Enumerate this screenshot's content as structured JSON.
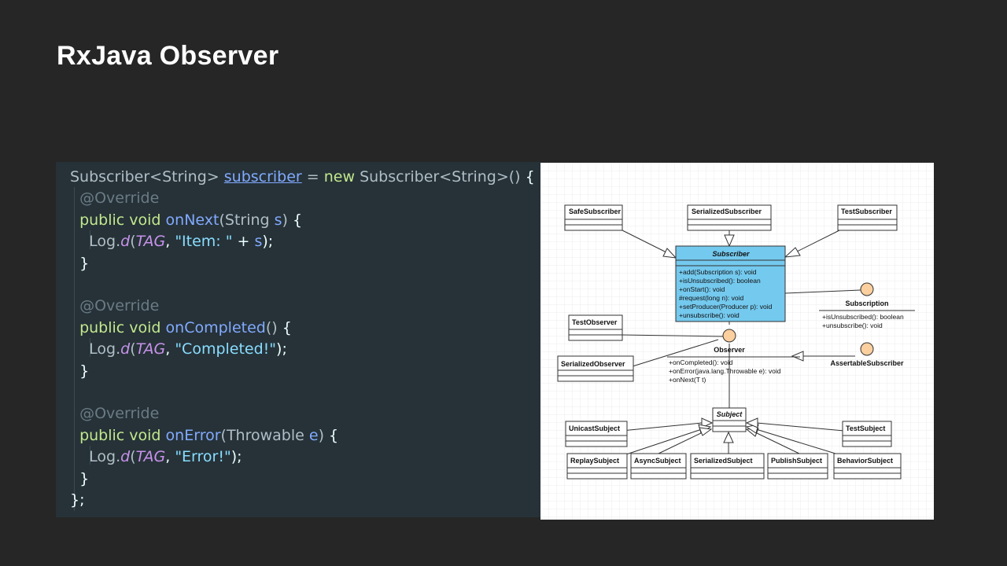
{
  "slide": {
    "title": "RxJava Observer"
  },
  "code": {
    "lines": [
      [
        {
          "t": "Subscriber<String> ",
          "c": "t-cls"
        },
        {
          "t": "subscriber",
          "c": "t-var"
        },
        {
          "t": " = ",
          "c": "t-plain"
        },
        {
          "t": "new ",
          "c": "t-kw"
        },
        {
          "t": "Subscriber<String>() ",
          "c": "t-cls"
        },
        {
          "t": "{",
          "c": "t-punc"
        }
      ],
      [
        {
          "t": "  @Override",
          "c": "t-ann"
        }
      ],
      [
        {
          "t": "  public void ",
          "c": "t-kw"
        },
        {
          "t": "onNext",
          "c": "t-fn"
        },
        {
          "t": "(String ",
          "c": "t-cls"
        },
        {
          "t": "s",
          "c": "t-param"
        },
        {
          "t": ") ",
          "c": "t-cls"
        },
        {
          "t": "{",
          "c": "t-punc"
        }
      ],
      [
        {
          "t": "    Log.",
          "c": "t-cls"
        },
        {
          "t": "d",
          "c": "t-ital"
        },
        {
          "t": "(",
          "c": "t-cls"
        },
        {
          "t": "TAG",
          "c": "t-ital"
        },
        {
          "t": ", ",
          "c": "t-punc"
        },
        {
          "t": "\"Item: \"",
          "c": "t-str"
        },
        {
          "t": " + ",
          "c": "t-punc"
        },
        {
          "t": "s",
          "c": "t-param"
        },
        {
          "t": ");",
          "c": "t-punc"
        }
      ],
      [
        {
          "t": "  }",
          "c": "t-punc"
        }
      ],
      [],
      [
        {
          "t": "  @Override",
          "c": "t-ann"
        }
      ],
      [
        {
          "t": "  public void ",
          "c": "t-kw"
        },
        {
          "t": "onCompleted",
          "c": "t-fn"
        },
        {
          "t": "() ",
          "c": "t-cls"
        },
        {
          "t": "{",
          "c": "t-punc"
        }
      ],
      [
        {
          "t": "    Log.",
          "c": "t-cls"
        },
        {
          "t": "d",
          "c": "t-ital"
        },
        {
          "t": "(",
          "c": "t-cls"
        },
        {
          "t": "TAG",
          "c": "t-ital"
        },
        {
          "t": ", ",
          "c": "t-punc"
        },
        {
          "t": "\"Completed!\"",
          "c": "t-str"
        },
        {
          "t": ");",
          "c": "t-punc"
        }
      ],
      [
        {
          "t": "  }",
          "c": "t-punc"
        }
      ],
      [],
      [
        {
          "t": "  @Override",
          "c": "t-ann"
        }
      ],
      [
        {
          "t": "  public void ",
          "c": "t-kw"
        },
        {
          "t": "onError",
          "c": "t-fn"
        },
        {
          "t": "(Throwable ",
          "c": "t-cls"
        },
        {
          "t": "e",
          "c": "t-param"
        },
        {
          "t": ") ",
          "c": "t-cls"
        },
        {
          "t": "{",
          "c": "t-punc"
        }
      ],
      [
        {
          "t": "    Log.",
          "c": "t-cls"
        },
        {
          "t": "d",
          "c": "t-ital"
        },
        {
          "t": "(",
          "c": "t-cls"
        },
        {
          "t": "TAG",
          "c": "t-ital"
        },
        {
          "t": ", ",
          "c": "t-punc"
        },
        {
          "t": "\"Error!\"",
          "c": "t-str"
        },
        {
          "t": ");",
          "c": "t-punc"
        }
      ],
      [
        {
          "t": "  }",
          "c": "t-punc"
        }
      ],
      [
        {
          "t": "};",
          "c": "t-punc"
        }
      ]
    ]
  },
  "uml": {
    "classes": {
      "safe": "SafeSubscriber",
      "serialized_sub": "SerializedSubscriber",
      "test_sub": "TestSubscriber",
      "subscriber": "Subscriber",
      "subscription": "Subscription",
      "test_observer": "TestObserver",
      "observer": "Observer",
      "serialized_observer": "SerializedObserver",
      "assertable": "AssertableSubscriber",
      "subject": "Subject",
      "unicast": "UnicastSubject",
      "test_subject": "TestSubject",
      "replay": "ReplaySubject",
      "async": "AsyncSubject",
      "serialized_subject": "SerializedSubject",
      "publish": "PublishSubject",
      "behavior": "BehaviorSubject"
    },
    "subscriber_methods": [
      "+add(Subscription s): void",
      "+isUnsubscribed(): boolean",
      "+onStart(): void",
      "#request(long n): void",
      "+setProducer(Producer p): void",
      "+unsubscribe(): void"
    ],
    "subscription_methods": [
      "+isUnsubscribed(): boolean",
      "+unsubscribe(): void"
    ],
    "observer_methods": [
      "+onCompleted(): void",
      "+onError(java.lang.Throwable e): void",
      "+onNext(T t)"
    ]
  }
}
